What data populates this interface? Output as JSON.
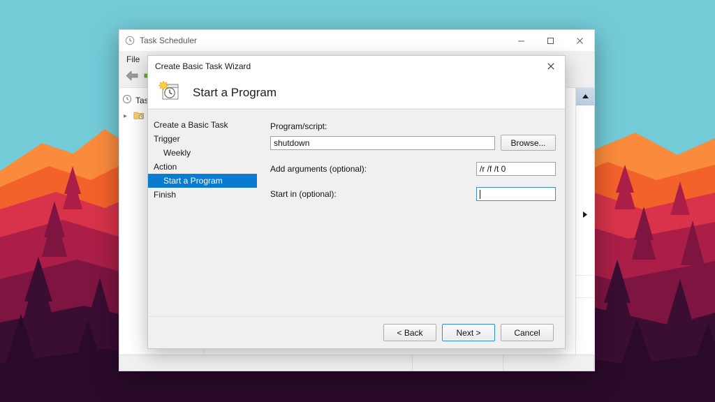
{
  "desktop": {
    "wallpaper_name": "firewatch-mountains-wallpaper",
    "colors": {
      "sky": "#74cbd8",
      "mountain_orange": "#f4622b",
      "mountain_orange_light": "#fb8b3c",
      "mountain_red": "#d8334a",
      "mountain_crimson": "#ab1e47",
      "mountain_maroon": "#7d1540",
      "mountain_dark": "#3a0d33",
      "mountain_darkest": "#2a0a2b"
    }
  },
  "task_scheduler": {
    "title": "Task Scheduler",
    "window_controls": {
      "minimize": "minimize",
      "maximize": "maximize",
      "close": "close"
    },
    "menu": {
      "items": [
        "File"
      ]
    },
    "toolbar": {
      "back": "Back",
      "forward": "Forward"
    },
    "tree": {
      "root_label": "Task",
      "child_label": ""
    },
    "statusbar": {
      "text": ""
    }
  },
  "wizard": {
    "title": "Create Basic Task Wizard",
    "close_label": "Close",
    "header": {
      "icon": "task-scheduler-icon",
      "title": "Start a Program"
    },
    "nav": {
      "items": [
        {
          "label": "Create a Basic Task",
          "level": 0,
          "selected": false
        },
        {
          "label": "Trigger",
          "level": 0,
          "selected": false
        },
        {
          "label": "Weekly",
          "level": 1,
          "selected": false
        },
        {
          "label": "Action",
          "level": 0,
          "selected": false
        },
        {
          "label": "Start a Program",
          "level": 1,
          "selected": true
        },
        {
          "label": "Finish",
          "level": 0,
          "selected": false
        }
      ],
      "selected_color": "#0b7ad1"
    },
    "form": {
      "program_label": "Program/script:",
      "program_value": "shutdown",
      "program_placeholder": "",
      "browse_label": "Browse...",
      "arguments_label": "Add arguments (optional):",
      "arguments_value": "/r /f /t 0",
      "arguments_placeholder": "",
      "startin_label": "Start in (optional):",
      "startin_value": "",
      "startin_placeholder": "",
      "startin_focused": true
    },
    "footer": {
      "back_label": "< Back",
      "next_label": "Next >",
      "cancel_label": "Cancel",
      "default_button": "Next >"
    }
  }
}
